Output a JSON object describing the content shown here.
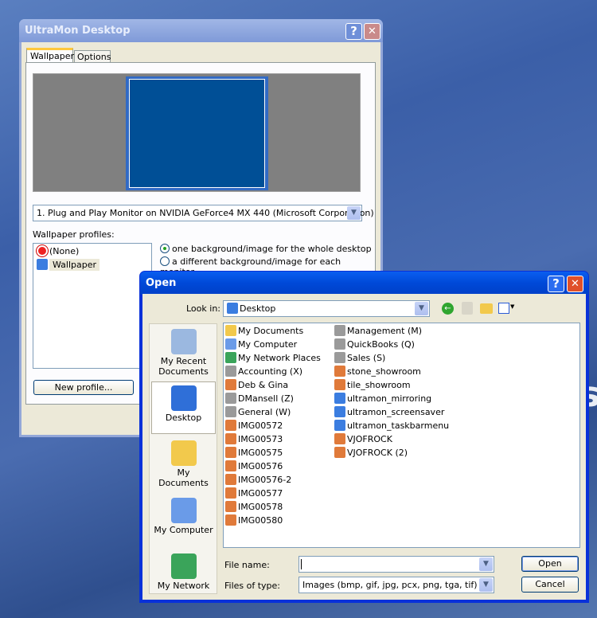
{
  "ultramon": {
    "title": "UltraMon Desktop",
    "tabs": [
      {
        "label": "Wallpaper"
      },
      {
        "label": "Options"
      }
    ],
    "monitor_select": "1. Plug and Play Monitor on NVIDIA GeForce4 MX 440 (Microsoft Corporation)",
    "profiles_label": "Wallpaper profiles:",
    "profiles": [
      {
        "label": "(None)",
        "icon": "no-entry-icon"
      },
      {
        "label": "Wallpaper",
        "icon": "wallpaper-profile-icon"
      }
    ],
    "radio_options": [
      {
        "label": "one background/image for the whole desktop",
        "selected": true
      },
      {
        "label": "a different background/image for each monitor",
        "selected": false
      }
    ],
    "new_profile": "New profile...",
    "help": "?",
    "close": "✕"
  },
  "open": {
    "title": "Open",
    "help": "?",
    "close": "✕",
    "look_in_label": "Look in:",
    "look_in_value": "Desktop",
    "places": [
      {
        "label": "My Recent Documents",
        "icon": "recent-documents-icon"
      },
      {
        "label": "Desktop",
        "icon": "desktop-icon",
        "selected": true
      },
      {
        "label": "My Documents",
        "icon": "my-documents-icon"
      },
      {
        "label": "My Computer",
        "icon": "my-computer-icon"
      },
      {
        "label": "My Network",
        "icon": "my-network-icon"
      }
    ],
    "files_col1": [
      {
        "n": "My Documents",
        "t": "folder"
      },
      {
        "n": "My Computer",
        "t": "computer"
      },
      {
        "n": "My Network Places",
        "t": "network"
      },
      {
        "n": "Accounting (X)",
        "t": "drive"
      },
      {
        "n": "Deb & Gina",
        "t": "image"
      },
      {
        "n": "DMansell (Z)",
        "t": "drive"
      },
      {
        "n": "General (W)",
        "t": "drive"
      },
      {
        "n": "IMG00572",
        "t": "image"
      },
      {
        "n": "IMG00573",
        "t": "image"
      },
      {
        "n": "IMG00575",
        "t": "image"
      },
      {
        "n": "IMG00576",
        "t": "image"
      },
      {
        "n": "IMG00576-2",
        "t": "image"
      },
      {
        "n": "IMG00577",
        "t": "image"
      },
      {
        "n": "IMG00578",
        "t": "image"
      },
      {
        "n": "IMG00580",
        "t": "image"
      }
    ],
    "files_col2": [
      {
        "n": "Management (M)",
        "t": "drive"
      },
      {
        "n": "QuickBooks (Q)",
        "t": "drive"
      },
      {
        "n": "Sales (S)",
        "t": "drive"
      },
      {
        "n": "stone_showroom",
        "t": "image"
      },
      {
        "n": "tile_showroom",
        "t": "image"
      },
      {
        "n": "ultramon_mirroring",
        "t": "ultramon"
      },
      {
        "n": "ultramon_screensaver",
        "t": "ultramon"
      },
      {
        "n": "ultramon_taskbarmenu",
        "t": "ultramon"
      },
      {
        "n": "VJOFROCK",
        "t": "image"
      },
      {
        "n": "VJOFROCK (2)",
        "t": "image"
      }
    ],
    "file_name_label": "File name:",
    "file_name_value": "",
    "files_of_type_label": "Files of type:",
    "files_of_type_value": "Images (bmp, gif, jpg, pcx, png, tga, tif)",
    "open_button": "Open",
    "cancel_button": "Cancel"
  },
  "colors": {
    "xp_title": "#0054e3",
    "monitor_blue": "#004f96"
  }
}
